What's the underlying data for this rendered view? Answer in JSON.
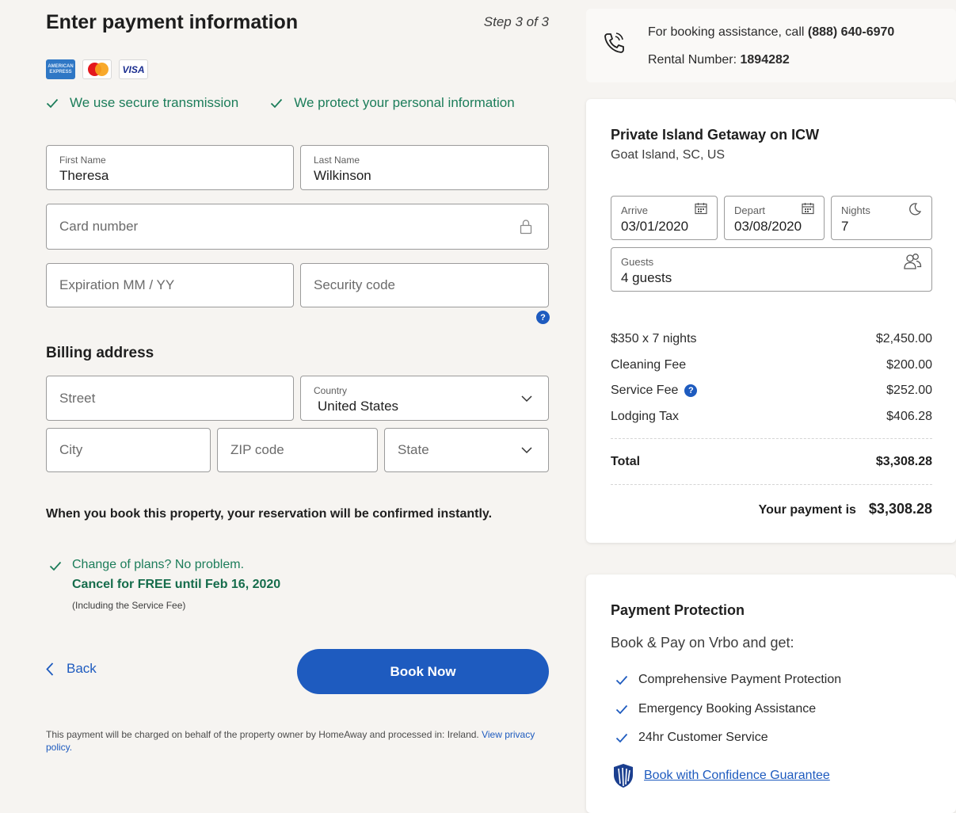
{
  "form": {
    "title": "Enter payment information",
    "step": "Step 3 of 3",
    "card_logos": [
      "AMERICAN EXPRESS",
      "mastercard",
      "VISA"
    ],
    "secure": [
      "We use secure transmission",
      "We protect your personal information"
    ],
    "first_name": {
      "label": "First Name",
      "value": "Theresa"
    },
    "last_name": {
      "label": "Last Name",
      "value": "Wilkinson"
    },
    "card_number": {
      "placeholder": "Card number"
    },
    "expiration": {
      "placeholder": "Expiration MM / YY"
    },
    "security_code": {
      "placeholder": "Security code"
    },
    "help_glyph": "?",
    "billing_title": "Billing address",
    "street": {
      "placeholder": "Street"
    },
    "country": {
      "label": "Country",
      "value": "United States"
    },
    "city": {
      "placeholder": "City"
    },
    "zip": {
      "placeholder": "ZIP code"
    },
    "state": {
      "placeholder": "State"
    },
    "instant_text": "When you book this property, your reservation will be confirmed instantly.",
    "plans": {
      "line1": "Change of plans? No problem.",
      "line2": "Cancel for FREE until Feb 16, 2020",
      "line3": "(Including the Service Fee)"
    },
    "back_label": "Back",
    "book_now_label": "Book Now",
    "legal_text": "This payment will be charged on behalf of the property owner by HomeAway and processed in: Ireland.",
    "legal_link": "View privacy policy."
  },
  "assistance": {
    "line1_prefix": "For booking assistance, call ",
    "phone": "(888) 640-6970",
    "line2_prefix": "Rental Number: ",
    "rental_number": "1894282"
  },
  "property": {
    "name": "Private Island Getaway on ICW",
    "location": "Goat Island, SC, US",
    "arrive": {
      "label": "Arrive",
      "value": "03/01/2020"
    },
    "depart": {
      "label": "Depart",
      "value": "03/08/2020"
    },
    "nights": {
      "label": "Nights",
      "value": "7"
    },
    "guests": {
      "label": "Guests",
      "value": "4 guests"
    },
    "prices": [
      {
        "name": "$350 x 7 nights",
        "amount": "$2,450.00"
      },
      {
        "name": "Cleaning Fee",
        "amount": "$200.00"
      },
      {
        "name": "Service Fee",
        "amount": "$252.00"
      },
      {
        "name": "Lodging Tax",
        "amount": "$406.28"
      }
    ],
    "total": {
      "label": "Total",
      "amount": "$3,308.28"
    },
    "payment": {
      "label": "Your payment is",
      "amount": "$3,308.28"
    }
  },
  "protection": {
    "title": "Payment Protection",
    "subtitle": "Book & Pay on Vrbo and get:",
    "items": [
      "Comprehensive Payment Protection",
      "Emergency Booking Assistance",
      "24hr Customer Service"
    ],
    "guarantee_link": "Book with Confidence Guarantee"
  },
  "colors": {
    "accent": "#1e5bbf",
    "success": "#1c7d5a",
    "background": "#f6f4f1"
  },
  "icons": [
    "check-icon",
    "lock-icon",
    "help-icon",
    "chevron-down-icon",
    "chevron-left-icon",
    "phone-icon",
    "calendar-icon",
    "moon-icon",
    "guests-icon",
    "shield-icon"
  ]
}
